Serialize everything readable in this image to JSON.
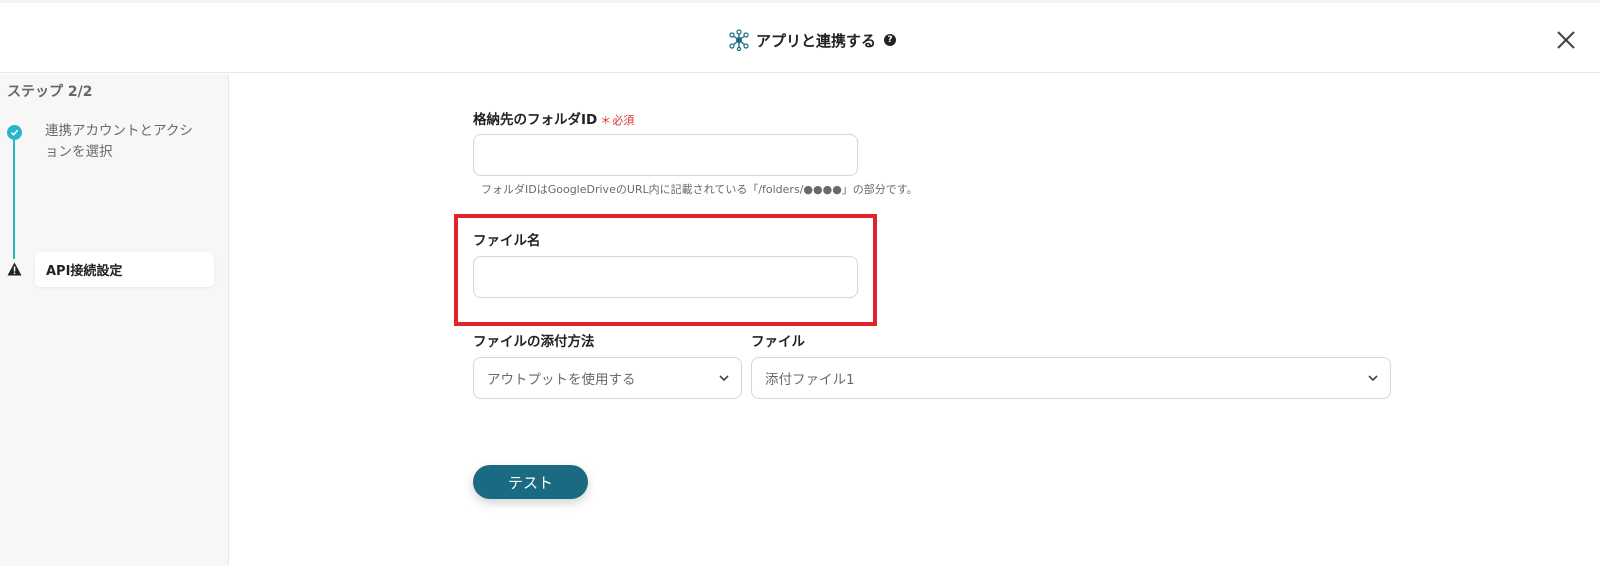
{
  "header": {
    "title": "アプリと連携する",
    "help_icon_glyph": "?"
  },
  "sidebar": {
    "step_heading": "ステップ 2/2",
    "steps": [
      {
        "label": "連携アカウントとアクションを選択",
        "status": "complete",
        "icon": "check-icon"
      },
      {
        "label": "API接続設定",
        "status": "warning",
        "icon": "warning-icon"
      }
    ]
  },
  "form": {
    "folder_id": {
      "label": "格納先のフォルダID",
      "required_mark": "＊",
      "required_text": "必須",
      "value": "",
      "hint": "フォルダIDはGoogleDriveのURL内に記載されている「/folders/●●●●」の部分です。"
    },
    "file_name": {
      "label": "ファイル名",
      "value": ""
    },
    "attach_method": {
      "label": "ファイルの添付方法",
      "selected": "アウトプットを使用する"
    },
    "file": {
      "label": "ファイル",
      "selected": "添付ファイル1"
    },
    "test_button_label": "テスト"
  },
  "colors": {
    "accent_teal": "#2ab5c8",
    "button_dark_teal": "#1a6a82",
    "highlight_red": "#e3222a",
    "required_red": "#e0313b"
  }
}
